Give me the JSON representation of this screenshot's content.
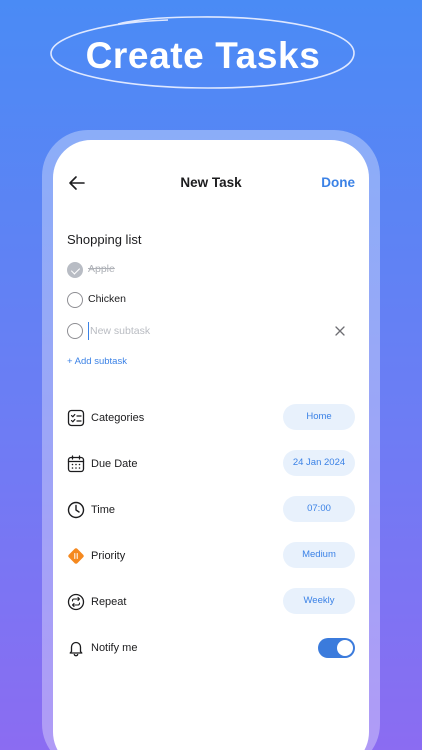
{
  "headline": "Create Tasks",
  "colors": {
    "accent": "#3b82e6",
    "pill_bg": "#e8f1fc",
    "priority": "#f5891f"
  },
  "nav": {
    "back_icon": "arrow-left-icon",
    "title": "New Task",
    "done_label": "Done"
  },
  "task": {
    "title": "Shopping list",
    "subtasks": [
      {
        "label": "Apple",
        "checked": true
      },
      {
        "label": "Chicken",
        "checked": false
      }
    ],
    "new_subtask_placeholder": "New subtask",
    "add_subtask_label": "+ Add subtask"
  },
  "settings": [
    {
      "label": "Categories",
      "value": "Home",
      "icon": "categories-icon"
    },
    {
      "label": "Due Date",
      "value": "24 Jan 2024",
      "icon": "calendar-icon"
    },
    {
      "label": "Time",
      "value": "07:00",
      "icon": "clock-icon"
    },
    {
      "label": "Priority",
      "value": "Medium",
      "icon": "priority-icon"
    },
    {
      "label": "Repeat",
      "value": "Weekly",
      "icon": "repeat-icon"
    },
    {
      "label": "Notify me",
      "toggle_on": true,
      "icon": "bell-icon"
    }
  ]
}
